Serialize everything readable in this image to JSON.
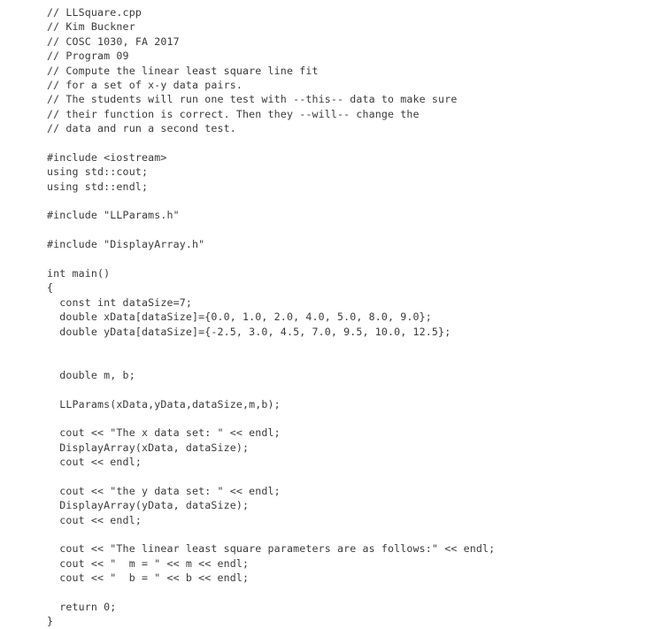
{
  "document": {
    "title": "LLSquare.cpp",
    "language": "cpp",
    "background_color": "#ffffff",
    "text_color": "#3a3a3a"
  },
  "header_comments": {
    "file": "LLSquare.cpp",
    "author": "Kim Buckner",
    "course": "COSC 1030, FA 2017",
    "program": "Program 09",
    "description_line_1": "Compute the linear least square line fit",
    "description_line_2": "for a set of x-y data pairs.",
    "description_line_3": "The students will run one test with --this-- data to make sure",
    "description_line_4": "their function is correct. Then they --will-- change the",
    "description_line_5": "data and run a second test."
  },
  "includes": [
    "#include <iostream>",
    "#include \"LLParams.h\"",
    "#include \"DisplayArray.h\""
  ],
  "using_declarations": [
    "using std::cout;",
    "using std::endl;"
  ],
  "variables": {
    "data_size_name": "dataSize",
    "data_size_value": "7",
    "x_array_name": "xData",
    "y_array_name": "yData",
    "slope_name": "m",
    "intercept_name": "b"
  },
  "data_sets": {
    "xData": [
      "0.0",
      "1.0",
      "2.0",
      "4.0",
      "5.0",
      "8.0",
      "9.0"
    ],
    "yData": [
      "-2.5",
      "3.0",
      "4.5",
      "7.0",
      "9.5",
      "10.0",
      "12.5"
    ]
  },
  "output_strings": {
    "x_data_label": "The x data set: ",
    "y_data_label": "the y data set: ",
    "parameters_label": "The linear least square parameters are as follows:",
    "m_label": "  m = ",
    "b_label": "  b = "
  },
  "functions_called": [
    "LLParams",
    "DisplayArray"
  ],
  "lines": [
    "// LLSquare.cpp",
    "// Kim Buckner",
    "// COSC 1030, FA 2017",
    "// Program 09",
    "// Compute the linear least square line fit",
    "// for a set of x-y data pairs.",
    "// The students will run one test with --this-- data to make sure",
    "// their function is correct. Then they --will-- change the",
    "// data and run a second test.",
    "",
    "#include <iostream>",
    "using std::cout;",
    "using std::endl;",
    "",
    "#include \"LLParams.h\"",
    "",
    "#include \"DisplayArray.h\"",
    "",
    "int main()",
    "{",
    "  const int dataSize=7;",
    "  double xData[dataSize]={0.0, 1.0, 2.0, 4.0, 5.0, 8.0, 9.0};",
    "  double yData[dataSize]={-2.5, 3.0, 4.5, 7.0, 9.5, 10.0, 12.5};",
    "",
    "",
    "  double m, b;",
    "",
    "  LLParams(xData,yData,dataSize,m,b);",
    "",
    "  cout << \"The x data set: \" << endl;",
    "  DisplayArray(xData, dataSize);",
    "  cout << endl;",
    "",
    "  cout << \"the y data set: \" << endl;",
    "  DisplayArray(yData, dataSize);",
    "  cout << endl;",
    "",
    "  cout << \"The linear least square parameters are as follows:\" << endl;",
    "  cout << \"  m = \" << m << endl;",
    "  cout << \"  b = \" << b << endl;",
    "",
    "  return 0;",
    "}"
  ]
}
